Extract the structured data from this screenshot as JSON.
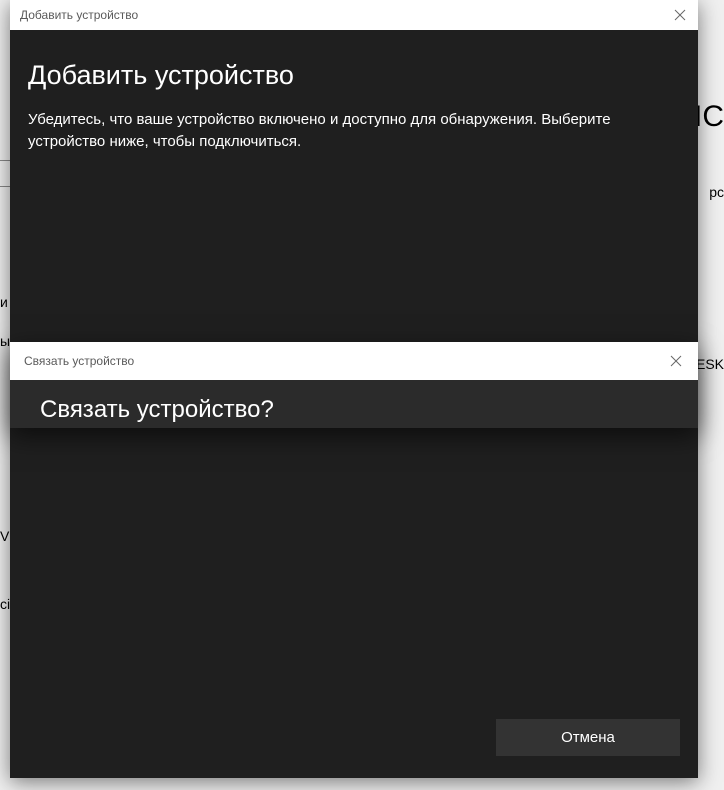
{
  "background": {
    "t1": "IC",
    "t2": "рс",
    "t3": "и",
    "t4": "ы",
    "t5": "ESK",
    "t6": "Vi",
    "t7": "сі"
  },
  "dialog1": {
    "windowTitle": "Добавить устройство",
    "heading": "Добавить устройство",
    "subtext": "Убедитесь, что ваше устройство включено и доступно для обнаружения. Выберите устройство ниже, чтобы подключиться.",
    "cancel": "Отмена"
  },
  "dialog2": {
    "windowTitle": "Связать устройство",
    "heading": "Связать устройство?"
  }
}
